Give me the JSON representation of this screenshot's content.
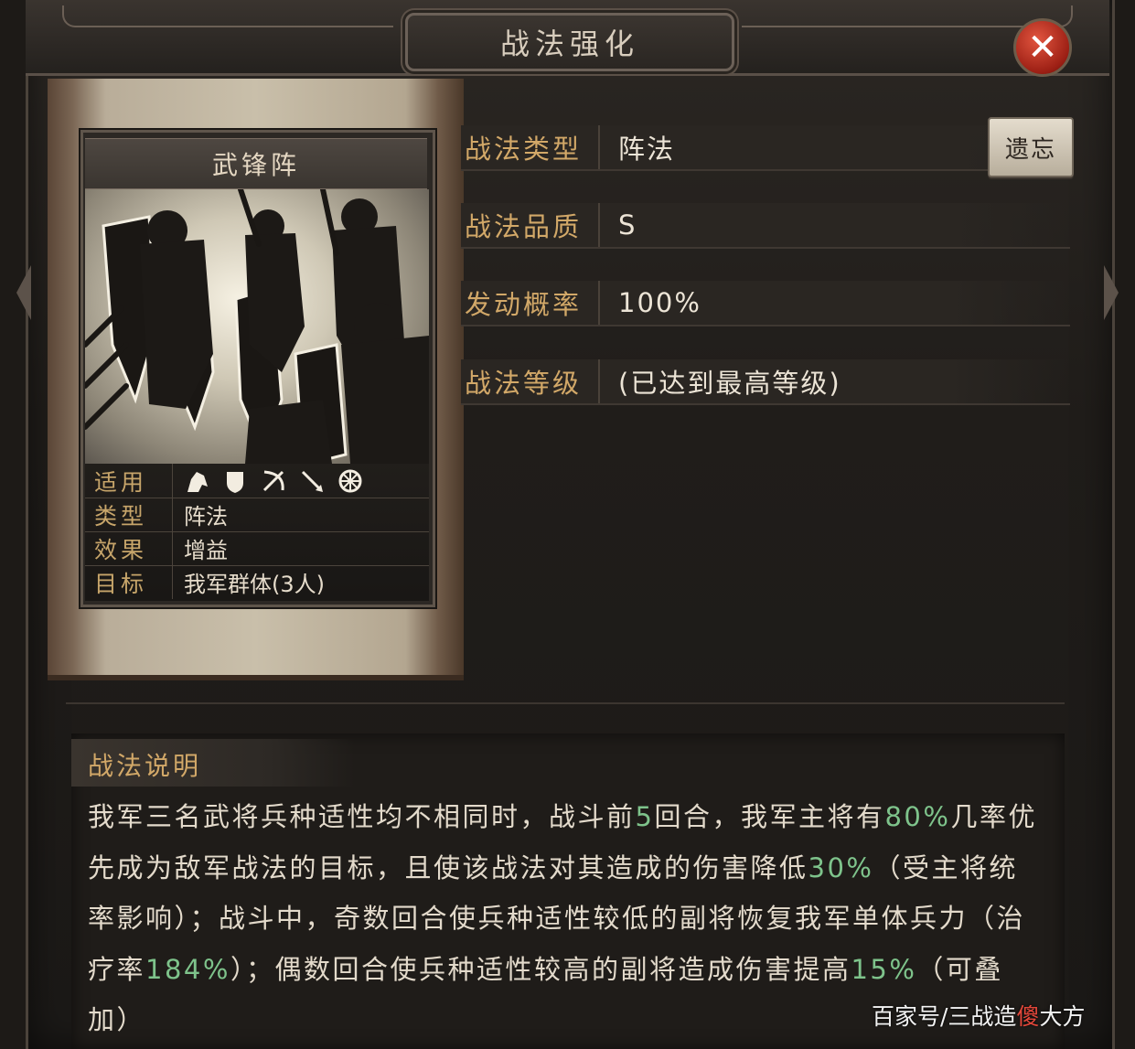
{
  "header": {
    "title": "战法强化",
    "close_label": "✕"
  },
  "card": {
    "name": "武锋阵",
    "props": [
      {
        "key": "适用",
        "value": ""
      },
      {
        "key": "类型",
        "value": "阵法"
      },
      {
        "key": "效果",
        "value": "增益"
      },
      {
        "key": "目标",
        "value": "我军群体(3人)"
      }
    ],
    "troop_icons": [
      "cavalry-icon",
      "shield-icon",
      "bow-icon",
      "spear-icon",
      "siege-icon"
    ]
  },
  "info": [
    {
      "key": "战法类型",
      "value": "阵法"
    },
    {
      "key": "战法品质",
      "value": "S"
    },
    {
      "key": "发动概率",
      "value": "100%"
    },
    {
      "key": "战法等级",
      "value": "(已达到最高等级)"
    }
  ],
  "forget_button": "遗忘",
  "description": {
    "title": "战法说明",
    "segments": [
      {
        "text": "我军三名武将兵种适性均不相同时，战斗前",
        "hl": false
      },
      {
        "text": "5",
        "hl": true
      },
      {
        "text": "回合，我军主将有",
        "hl": false
      },
      {
        "text": "80%",
        "hl": true
      },
      {
        "text": "几率优先成为敌军战法的目标，且使该战法对其造成的伤害降低",
        "hl": false
      },
      {
        "text": "30%",
        "hl": true
      },
      {
        "text": "（受主将统率影响）；战斗中，奇数回合使兵种适性较低的副将恢复我军单体兵力（治疗率",
        "hl": false
      },
      {
        "text": "184%",
        "hl": true
      },
      {
        "text": "）；偶数回合使兵种适性较高的副将造成伤害提高",
        "hl": false
      },
      {
        "text": "15%",
        "hl": true
      },
      {
        "text": "（可叠加）",
        "hl": false
      }
    ]
  },
  "watermark": {
    "prefix": "百家号/三战造",
    "red": "傻",
    "suffix": "大方"
  },
  "colors": {
    "accent_gold": "#d2a868",
    "highlight_green": "#7ec38b",
    "close_red": "#c0392b"
  }
}
